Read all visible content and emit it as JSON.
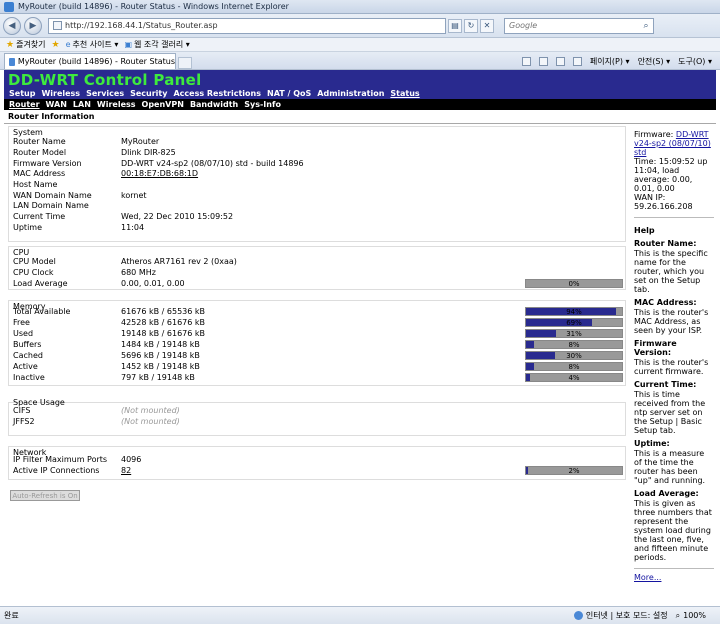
{
  "window": {
    "title": "MyRouter (build 14896) - Router Status - Windows Internet Explorer"
  },
  "address": {
    "url": "http://192.168.44.1/Status_Router.asp",
    "search_placeholder": "Google"
  },
  "favorites": {
    "label": "즐겨찾기",
    "items": [
      "추천 사이트 ▾",
      "웹 조각 갤러리 ▾"
    ]
  },
  "tab": {
    "title": "MyRouter (build 14896) - Router Status"
  },
  "commands": [
    "페이지(P) ▾",
    "안전(S) ▾",
    "도구(O) ▾"
  ],
  "panel": {
    "logo": "DD-WRT Control Panel",
    "menu": [
      "Setup",
      "Wireless",
      "Services",
      "Security",
      "Access Restrictions",
      "NAT / QoS",
      "Administration",
      "Status"
    ],
    "active_menu": "Status",
    "submenu": [
      "Router",
      "WAN",
      "LAN",
      "Wireless",
      "OpenVPN",
      "Bandwidth",
      "Sys-Info"
    ],
    "active_submenu": "Router",
    "section_title": "Router Information"
  },
  "system": {
    "legend": "System",
    "rows": [
      {
        "label": "Router Name",
        "value": "MyRouter"
      },
      {
        "label": "Router Model",
        "value": "Dlink DIR-825"
      },
      {
        "label": "Firmware Version",
        "value": "DD-WRT v24-sp2 (08/07/10) std - build 14896"
      },
      {
        "label": "MAC Address",
        "value": "00:18:E7:DB:68:1D"
      },
      {
        "label": "Host Name",
        "value": ""
      },
      {
        "label": "WAN Domain Name",
        "value": "kornet"
      },
      {
        "label": "LAN Domain Name",
        "value": ""
      },
      {
        "label": "Current Time",
        "value": "Wed, 22 Dec 2010 15:09:52"
      },
      {
        "label": "Uptime",
        "value": "11:04"
      }
    ]
  },
  "cpu": {
    "legend": "CPU",
    "rows": [
      {
        "label": "CPU Model",
        "value": "Atheros AR7161 rev 2 (0xaa)"
      },
      {
        "label": "CPU Clock",
        "value": "680 MHz"
      },
      {
        "label": "Load Average",
        "value": "0.00, 0.01, 0.00",
        "meter": "0%",
        "pct": 0
      }
    ]
  },
  "memory": {
    "legend": "Memory",
    "rows": [
      {
        "label": "Total Available",
        "value": "61676 kB / 65536 kB",
        "meter": "94%",
        "pct": 94
      },
      {
        "label": "Free",
        "value": "42528 kB / 61676 kB",
        "meter": "69%",
        "pct": 69
      },
      {
        "label": "Used",
        "value": "19148 kB / 61676 kB",
        "meter": "31%",
        "pct": 31
      },
      {
        "label": "Buffers",
        "value": "1484 kB / 19148 kB",
        "meter": "8%",
        "pct": 8
      },
      {
        "label": "Cached",
        "value": "5696 kB / 19148 kB",
        "meter": "30%",
        "pct": 30
      },
      {
        "label": "Active",
        "value": "1452 kB / 19148 kB",
        "meter": "8%",
        "pct": 8
      },
      {
        "label": "Inactive",
        "value": "797 kB / 19148 kB",
        "meter": "4%",
        "pct": 4
      }
    ]
  },
  "space": {
    "legend": "Space Usage",
    "rows": [
      {
        "label": "CIFS",
        "value": "(Not mounted)"
      },
      {
        "label": "JFFS2",
        "value": "(Not mounted)"
      }
    ]
  },
  "network": {
    "legend": "Network",
    "rows": [
      {
        "label": "IP Filter Maximum Ports",
        "value": "4096"
      },
      {
        "label": "Active IP Connections",
        "value": "82",
        "meter": "2%",
        "pct": 2
      }
    ]
  },
  "autorefresh": "Auto-Refresh is On",
  "side": {
    "firmware_label": "Firmware:",
    "firmware_link": "DD-WRT v24-sp2 (08/07/10) std",
    "time_text": "Time: 15:09:52 up 11:04, load average: 0.00, 0.01, 0.00",
    "wan_ip": "WAN IP: 59.26.166.208",
    "help_title": "Help",
    "help": [
      {
        "term": "Router Name:",
        "desc": "This is the specific name for the router, which you set on the Setup tab."
      },
      {
        "term": "MAC Address:",
        "desc": "This is the router's MAC Address, as seen by your ISP."
      },
      {
        "term": "Firmware Version:",
        "desc": "This is the router's current firmware."
      },
      {
        "term": "Current Time:",
        "desc": "This is time received from the ntp server set on the Setup | Basic Setup tab."
      },
      {
        "term": "Uptime:",
        "desc": "This is a measure of the time the router has been \"up\" and running."
      },
      {
        "term": "Load Average:",
        "desc": "This is given as three numbers that represent the system load during the last one, five, and fifteen minute periods."
      }
    ],
    "more": "More..."
  },
  "status": {
    "left": "완료",
    "zone": "인터넷 | 보호 모드: 설정",
    "zoom": "100%"
  }
}
